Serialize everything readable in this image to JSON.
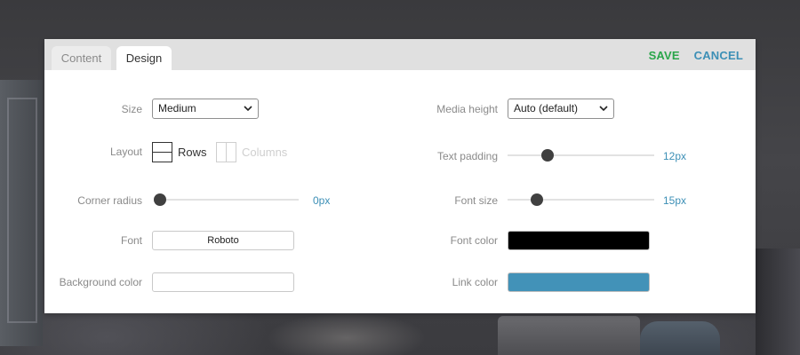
{
  "tabs": [
    {
      "label": "Content",
      "active": false
    },
    {
      "label": "Design",
      "active": true
    }
  ],
  "actions": {
    "save_label": "SAVE",
    "cancel_label": "CANCEL"
  },
  "left": {
    "size": {
      "label": "Size",
      "value": "Medium"
    },
    "layout": {
      "label": "Layout",
      "options": [
        "Rows",
        "Columns"
      ],
      "selected": "Rows"
    },
    "corner_radius": {
      "label": "Corner radius",
      "value_text": "0px",
      "value_fraction": 0.0
    },
    "font": {
      "label": "Font",
      "value": "Roboto"
    },
    "background_color": {
      "label": "Background color",
      "value": ""
    }
  },
  "right": {
    "media_height": {
      "label": "Media height",
      "value": "Auto (default)"
    },
    "text_padding": {
      "label": "Text padding",
      "value_text": "12px",
      "value_fraction": 0.27
    },
    "font_size": {
      "label": "Font size",
      "value_text": "15px",
      "value_fraction": 0.2
    },
    "font_color": {
      "label": "Font color",
      "color": "#000000"
    },
    "link_color": {
      "label": "Link color",
      "color": "#4292b8"
    }
  },
  "colors": {
    "save": "#2aa64a",
    "cancel": "#3c8fb6",
    "value_text": "#3c8fb6"
  }
}
